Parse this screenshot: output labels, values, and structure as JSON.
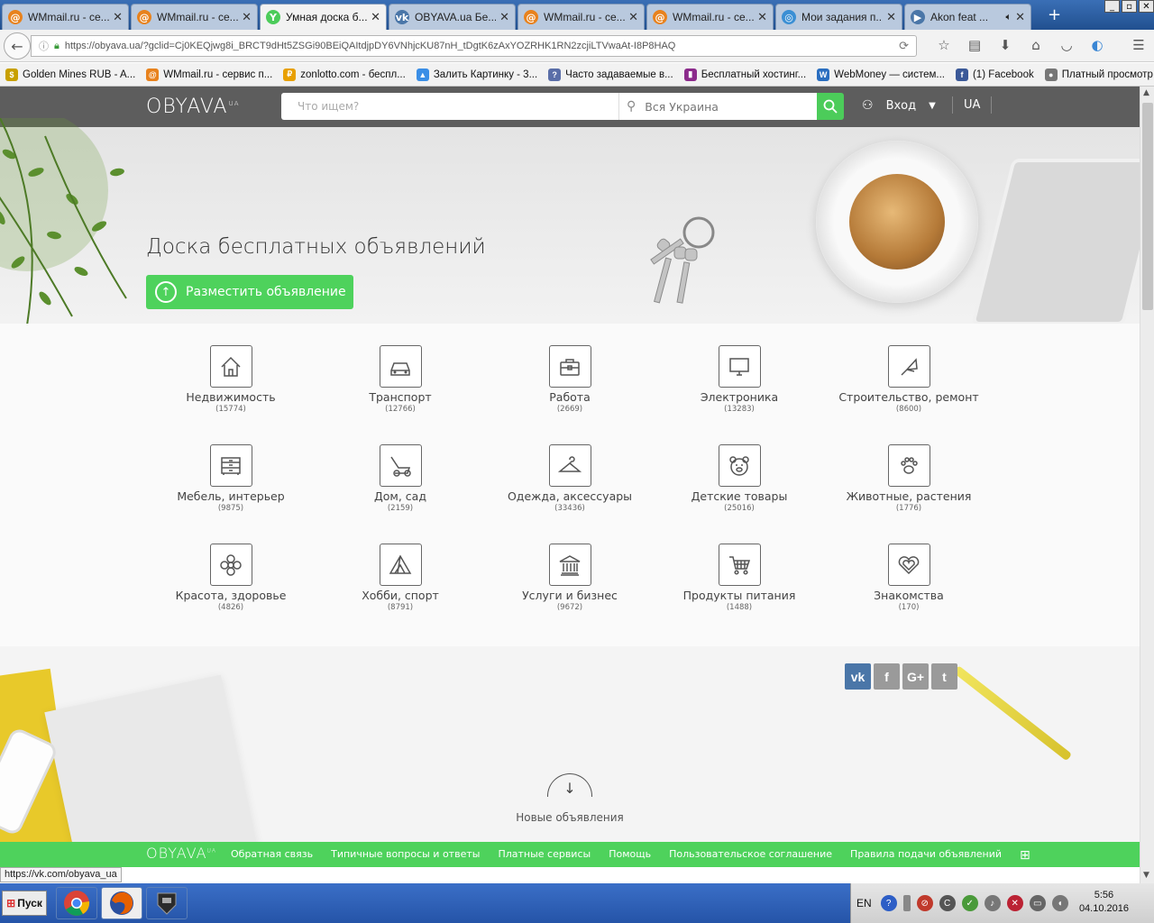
{
  "browser": {
    "tabs": [
      {
        "label": "WMmail.ru - се...",
        "icon": "at-icon",
        "color": "#e8821d"
      },
      {
        "label": "WMmail.ru - се...",
        "icon": "at-icon",
        "color": "#e8821d"
      },
      {
        "label": "Умная доска б...",
        "icon": "y-icon",
        "color": "#4ccc5a",
        "active": true
      },
      {
        "label": "OBYAVA.ua Бе...",
        "icon": "vk-icon",
        "color": "#4a76a8"
      },
      {
        "label": "WMmail.ru - се...",
        "icon": "at-icon",
        "color": "#e8821d"
      },
      {
        "label": "WMmail.ru - се...",
        "icon": "at-icon",
        "color": "#e8821d"
      },
      {
        "label": "Мои задания п...",
        "icon": "swirl-icon",
        "color": "#3b8fd4"
      },
      {
        "label": "Akon feat ...",
        "icon": "play-icon",
        "color": "#4a76a8"
      }
    ],
    "url": "https://obyava.ua/?gclid=Cj0KEQjwg8i_BRCT9dHt5ZSGi90BEiQAItdjpDY6VNhjcKU87nH_tDgtK6zAxYOZRHK1RN2zcjiLTVwaAt-I8P8HAQ",
    "bookmarks": [
      {
        "label": "Golden Mines RUB - A...",
        "color": "#c8a000",
        "glyph": "$"
      },
      {
        "label": "WMmail.ru - сервис п...",
        "color": "#e8821d",
        "glyph": "@"
      },
      {
        "label": "zonlotto.com - беспл...",
        "color": "#e8a000",
        "glyph": "₽"
      },
      {
        "label": "Залить Картинку - 3...",
        "color": "#3a8ee6",
        "glyph": "▲"
      },
      {
        "label": "Часто задаваемые в...",
        "color": "#5a6ea8",
        "glyph": "?"
      },
      {
        "label": "Бесплатный хостинг...",
        "color": "#8b2a8b",
        "glyph": "▮"
      },
      {
        "label": "WebMoney — систем...",
        "color": "#2a6ec0",
        "glyph": "W"
      },
      {
        "label": "(1) Facebook",
        "color": "#3b5998",
        "glyph": "f"
      },
      {
        "label": "Платный просмотр с...",
        "color": "#777777",
        "glyph": "●"
      }
    ],
    "status_link": "https://vk.com/obyava_ua"
  },
  "site": {
    "logo": "OBYAVA",
    "logo_sup": "UA",
    "search_placeholder": "Что ищем?",
    "region": "Вся Украина",
    "login": "Вход",
    "lang": "UA",
    "hero_title": "Доска бесплатных объявлений",
    "post_button": "Разместить объявление",
    "categories": [
      {
        "name": "Недвижимость",
        "count": "(15774)",
        "icon": "house-icon"
      },
      {
        "name": "Транспорт",
        "count": "(12766)",
        "icon": "car-icon"
      },
      {
        "name": "Работа",
        "count": "(2669)",
        "icon": "briefcase-icon"
      },
      {
        "name": "Электроника",
        "count": "(13283)",
        "icon": "monitor-icon"
      },
      {
        "name": "Строительство, ремонт",
        "count": "(8600)",
        "icon": "trowel-icon"
      },
      {
        "name": "Мебель, интерьер",
        "count": "(9875)",
        "icon": "dresser-icon"
      },
      {
        "name": "Дом, сад",
        "count": "(2159)",
        "icon": "lawnmower-icon"
      },
      {
        "name": "Одежда, аксессуары",
        "count": "(33436)",
        "icon": "hanger-icon"
      },
      {
        "name": "Детские товары",
        "count": "(25016)",
        "icon": "teddy-bear-icon"
      },
      {
        "name": "Животные, растения",
        "count": "(1776)",
        "icon": "paw-icon"
      },
      {
        "name": "Красота, здоровье",
        "count": "(4826)",
        "icon": "flower-icon"
      },
      {
        "name": "Хобби, спорт",
        "count": "(8791)",
        "icon": "tent-icon"
      },
      {
        "name": "Услуги и бизнес",
        "count": "(9672)",
        "icon": "bank-icon"
      },
      {
        "name": "Продукты питания",
        "count": "(1488)",
        "icon": "cart-icon"
      },
      {
        "name": "Знакомства",
        "count": "(170)",
        "icon": "hearts-icon"
      }
    ],
    "social": [
      {
        "label": "vk",
        "color": "#4a76a8",
        "icon": "vk-icon"
      },
      {
        "label": "f",
        "color": "#9a9a9a",
        "icon": "facebook-icon"
      },
      {
        "label": "G+",
        "color": "#9a9a9a",
        "icon": "google-plus-icon"
      },
      {
        "label": "t",
        "color": "#9a9a9a",
        "icon": "twitter-icon"
      }
    ],
    "new_ads": "Новые объявления",
    "footer_links": [
      "Обратная связь",
      "Типичные вопросы и ответы",
      "Платные сервисы",
      "Помощь",
      "Пользовательское соглашение",
      "Правила подачи объявлений"
    ],
    "accent_color": "#4ed25c"
  },
  "taskbar": {
    "start": "Пуск",
    "lang": "EN",
    "time": "5:56",
    "date": "04.10.2016"
  }
}
